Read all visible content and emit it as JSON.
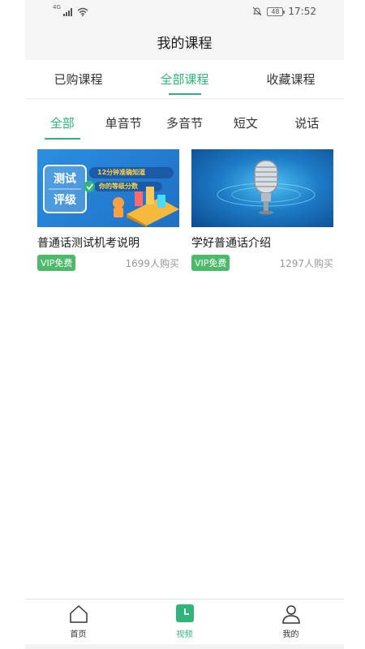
{
  "status_bar": {
    "network": "4G",
    "battery": "48",
    "time": "17:52"
  },
  "header": {
    "title": "我的课程"
  },
  "tabs": [
    {
      "label": "已购课程",
      "active": false
    },
    {
      "label": "全部课程",
      "active": true
    },
    {
      "label": "收藏课程",
      "active": false
    }
  ],
  "subtabs": [
    {
      "label": "全部",
      "active": true
    },
    {
      "label": "单音节",
      "active": false
    },
    {
      "label": "多音节",
      "active": false
    },
    {
      "label": "短文",
      "active": false
    },
    {
      "label": "说话",
      "active": false
    }
  ],
  "courses": [
    {
      "title": "普通话测试机考说明",
      "badge": "VIP免费",
      "buyers": "1699人购买",
      "thumb_text_line1": "测试",
      "thumb_text_line2": "评级",
      "thumb_caption_1": "12分钟准确知道",
      "thumb_caption_2": "你的等级分数"
    },
    {
      "title": "学好普通话介绍",
      "badge": "VIP免费",
      "buyers": "1297人购买"
    }
  ],
  "bottom_nav": [
    {
      "label": "首页",
      "icon": "home-icon",
      "active": false
    },
    {
      "label": "视频",
      "icon": "video-icon",
      "active": true
    },
    {
      "label": "我的",
      "icon": "profile-icon",
      "active": false
    }
  ],
  "colors": {
    "accent": "#2fb57a",
    "badge": "#4cba6a",
    "header_bg": "#f5f5f5"
  }
}
